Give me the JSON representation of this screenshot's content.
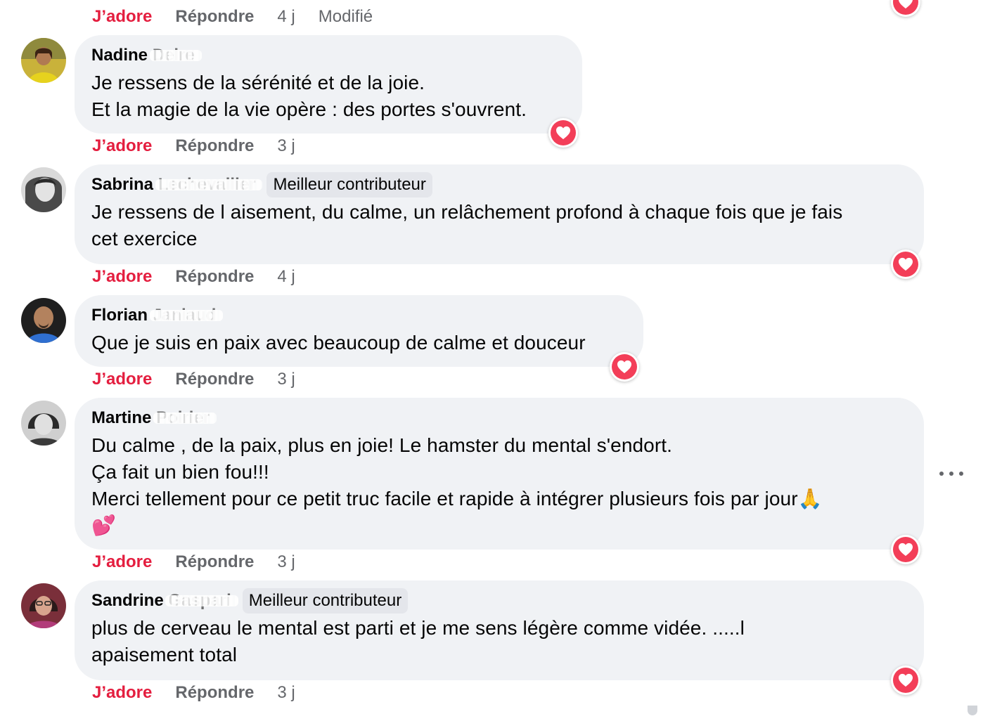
{
  "colors": {
    "bubble": "#f0f2f5",
    "love": "#e41e3f",
    "meta": "#65676b",
    "heart_reaction": "#f33e58"
  },
  "top_actions": {
    "like": "J’adore",
    "reply": "Répondre",
    "time": "4 j",
    "edited": "Modifié"
  },
  "comments": [
    {
      "first_name": "Nadine",
      "last_name_obscured": "Delre",
      "badge": "",
      "lines": [
        "Je ressens de la sérénité et de la joie.",
        "Et la magie de la vie opère : des portes s'ouvrent."
      ],
      "reaction_icon": "heart-reaction-icon",
      "actions": {
        "like": "J’adore",
        "reply": "Répondre",
        "time": "3 j"
      }
    },
    {
      "first_name": "Sabrina",
      "last_name_obscured": "Lechevallier",
      "badge": "Meilleur contributeur",
      "lines": [
        "Je ressens de l aisement, du calme, un relâchement profond à chaque fois que je fais",
        "cet exercice"
      ],
      "reaction_icon": "heart-reaction-icon",
      "actions": {
        "like": "J’adore",
        "reply": "Répondre",
        "time": "4 j"
      }
    },
    {
      "first_name": "Florian",
      "last_name_obscured": "Janiaud",
      "badge": "",
      "lines": [
        "Que je suis en paix avec beaucoup de calme et douceur"
      ],
      "reaction_icon": "heart-reaction-icon",
      "actions": {
        "like": "J’adore",
        "reply": "Répondre",
        "time": "3 j"
      }
    },
    {
      "first_name": "Martine",
      "last_name_obscured": "Poirier",
      "badge": "",
      "lines": [
        "Du calme , de la paix, plus en joie! Le hamster du mental s'endort.",
        "Ça fait un bien fou!!!",
        "Merci tellement pour ce petit truc facile et rapide à intégrer plusieurs fois par jour🙏",
        "💕"
      ],
      "reaction_icon": "heart-reaction-icon",
      "actions": {
        "like": "J’adore",
        "reply": "Répondre",
        "time": "3 j"
      }
    },
    {
      "first_name": "Sandrine",
      "last_name_obscured": "Gaspari",
      "badge": "Meilleur contributeur",
      "lines": [
        "plus de cerveau le mental est parti et je me sens légère comme vidée. .....l",
        "apaisement total"
      ],
      "reaction_icon": "heart-reaction-icon",
      "actions": {
        "like": "J’adore",
        "reply": "Répondre",
        "time": "3 j"
      }
    }
  ]
}
